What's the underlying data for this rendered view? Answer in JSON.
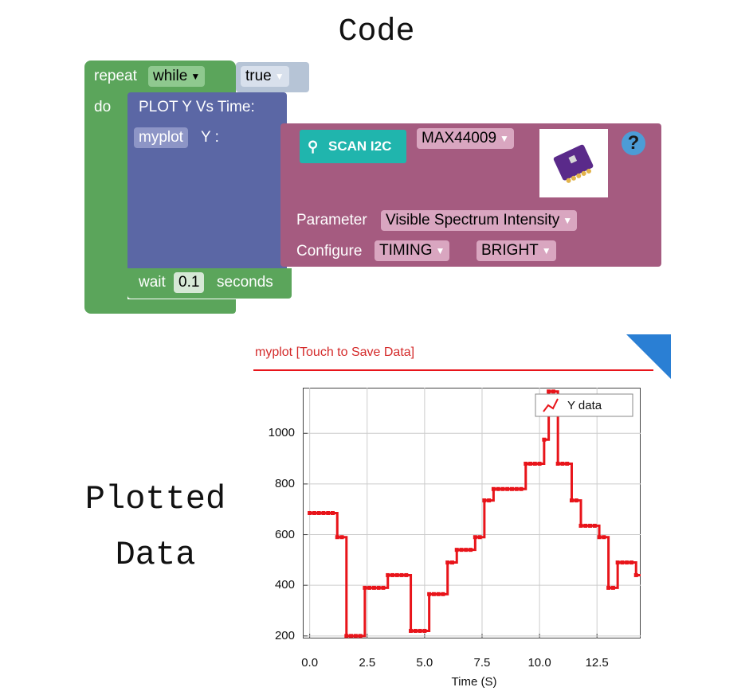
{
  "code_title": "Code",
  "plotted_title_line1": "Plotted",
  "plotted_title_line2": "Data",
  "blocks": {
    "repeat_label": "repeat",
    "while_dropdown": "while",
    "true_dropdown": "true",
    "do_label": "do",
    "plot_title": "PLOT Y Vs Time:",
    "plot_var": "myplot",
    "plot_y_label": "Y :",
    "scan_button": "SCAN I2C",
    "sensor_dropdown": "MAX44009",
    "help_symbol": "?",
    "parameter_label": "Parameter",
    "parameter_value": "Visible Spectrum Intensity",
    "configure_label": "Configure",
    "configure_timing": "TIMING",
    "configure_bright": "BRIGHT",
    "wait_label": "wait",
    "wait_value": "0.1",
    "seconds_label": "seconds"
  },
  "plot_header": "myplot [Touch to Save Data]",
  "colors": {
    "green": "#5ba55b",
    "blue": "#5b67a5",
    "magenta": "#a55b80",
    "series": "#e8141a",
    "corner": "#2a7fd4"
  },
  "chart_data": {
    "type": "line",
    "title": "",
    "xlabel": "Time (S)",
    "ylabel": "",
    "xlim": [
      -0.3,
      14.4
    ],
    "ylim": [
      190,
      1180
    ],
    "xticks": [
      0.0,
      2.5,
      5.0,
      7.5,
      10.0,
      12.5
    ],
    "xtick_labels": [
      "0.0",
      "2.5",
      "5.0",
      "7.5",
      "10.0",
      "12.5"
    ],
    "yticks": [
      200,
      400,
      600,
      800,
      1000
    ],
    "ytick_labels": [
      "200",
      "400",
      "600",
      "800",
      "1000"
    ],
    "legend": "top-right",
    "grid": true,
    "series": [
      {
        "name": "Y data",
        "x": [
          0.0,
          0.2,
          0.4,
          0.6,
          0.8,
          1.0,
          1.2,
          1.4,
          1.6,
          1.8,
          2.0,
          2.2,
          2.4,
          2.6,
          2.8,
          3.0,
          3.2,
          3.4,
          3.6,
          3.8,
          4.0,
          4.2,
          4.4,
          4.6,
          4.8,
          5.0,
          5.2,
          5.4,
          5.6,
          5.8,
          6.0,
          6.2,
          6.4,
          6.6,
          6.8,
          7.0,
          7.2,
          7.4,
          7.6,
          7.8,
          8.0,
          8.2,
          8.4,
          8.6,
          8.8,
          9.0,
          9.2,
          9.4,
          9.6,
          9.8,
          10.0,
          10.2,
          10.4,
          10.6,
          10.8,
          11.0,
          11.2,
          11.4,
          11.6,
          11.8,
          12.0,
          12.2,
          12.4,
          12.6,
          12.8,
          13.0,
          13.2,
          13.4,
          13.6,
          13.8,
          14.0,
          14.2
        ],
        "y": [
          685,
          685,
          685,
          685,
          685,
          685,
          590,
          590,
          200,
          200,
          200,
          200,
          390,
          390,
          390,
          390,
          390,
          440,
          440,
          440,
          440,
          440,
          220,
          220,
          220,
          220,
          365,
          365,
          365,
          365,
          490,
          490,
          540,
          540,
          540,
          540,
          590,
          590,
          735,
          735,
          780,
          780,
          780,
          780,
          780,
          780,
          780,
          880,
          880,
          880,
          880,
          975,
          1165,
          1165,
          880,
          880,
          880,
          735,
          735,
          635,
          635,
          635,
          635,
          590,
          590,
          390,
          390,
          490,
          490,
          490,
          490,
          440
        ]
      }
    ]
  }
}
